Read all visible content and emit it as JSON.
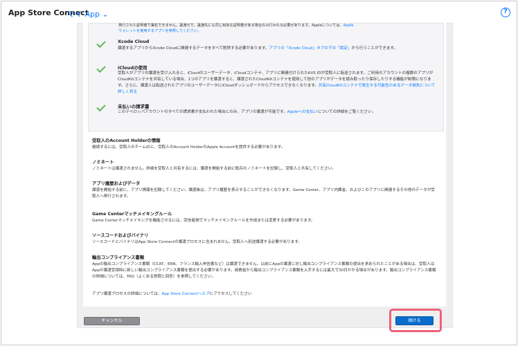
{
  "header": {
    "app_title": "App Store Connect",
    "my_apps": "マイ App ⌄",
    "help_icon": "?"
  },
  "top_fragment": {
    "line1": "発行された証明書で署名できません。譲渡元で、譲渡先にも同じ有効な証明書がある場合のみ行われる必要があります。Appleについては、",
    "line1_link": "Apple",
    "line2_link": "ウォレットを使用するアプリを参照してください。"
  },
  "checks": [
    {
      "title": "Xcode Cloud",
      "body_a": "譲渡するアプリからXcode Cloudに関連するデータをすべて削除する必要があります。",
      "body_link": "アプリの「Xcode Cloud」タブの下の「設定」",
      "body_b": "から行うことができます。"
    },
    {
      "title": "iCloudの使用",
      "body_a": "受取人がアプリの譲渡を受け入れると、iCloudのユーザーデータ、iCloudコンテナ、アプリに関連付けられたKVS IDが受取人に転送されます。ご利用のアカウントの複数のアプリがCloudKitコンテナを共有している場合、1つのアプリを譲渡すると、譲渡されたCloudKitコンテナを使用して他のアプリがデータを読み取ったり保存したりする機能が制限になります。さらに、譲渡人は転送されたアプリのユーザーデータにiCloudダッシュボードからアクセスできなくなります。",
      "body_link": "共有CloudKitコンテナで発生する可能性のあるデータ損失について詳しく見る",
      "body_b": ""
    },
    {
      "title": "未払いの請求書",
      "body_a": "このデベロッパアカウントのすべての請求書が支払われた場合にのみ、アプリの譲渡が可能です。",
      "body_link": "Appleへの支払い",
      "body_b": "についての詳細をご覧ください。"
    }
  ],
  "sections": [
    {
      "title": "受取人のAccount Holderの情報",
      "body": "継続するには、受取人のチームIDと、受取人のAccount HolderのApple Accountを提供する必要があります。"
    },
    {
      "title": "ノミネート",
      "body": "ノミネートは譲渡されません。詳細を受取人と共有するには、譲渡を開始する前に既存のノミネートを記録し、受取人と共有してください。"
    },
    {
      "title": "アプリ履歴およびデータ",
      "body": "譲渡を開始する前に、アプリ情報を記録してください。譲渡後は、アプリ履歴を表示することができなくなります。Game Center、アプリ内課金、およびこのアプリに関連するその他のデータが受取人へ移行されます。"
    },
    {
      "title": "Game Centerマッチメイキングルール",
      "body": "Game Centerマッチメイキングを機能させるには、受信者側でマッチメイキングルールを作成または変更する必要があります。"
    },
    {
      "title": "ソースコードおよびバイナリ",
      "body": "ソースコードとバイナリはApp Store Connectの譲渡プロセスに含まれません。受取人へ別途譲渡する必要があります。"
    },
    {
      "title": "輸出コンプライアンス書類",
      "body": "Appの輸出コンプライアンス書類（CCAT、ERN、フランス輸入申告書など）は譲渡できません。以前にAppの譲渡に対し輸出コンプライアンス書類の提出を求められたことがある場合は、受取人はAppの譲渡受領時に新しい輸出コンプライアンス書類を提出する必要があります。商務省から輸出コンプライアンス書類を入手するには最大で30日かかる場合があります。輸出コンプライアンス書類の詳細については、FAQ（よくある質問と回答）を参照してください。"
    }
  ],
  "footer_note": {
    "text_a": "アプリ譲渡プロセスの詳細については、",
    "link": "App Store Connectヘルプ",
    "text_b": "にアクセスしてください"
  },
  "buttons": {
    "cancel": "キャンセル",
    "continue": "続ける"
  },
  "colors": {
    "accent": "#0a7aff",
    "check": "#5cb85c",
    "highlight": "#f0607a",
    "continue_bg": "#0a6ccc",
    "cancel_bg": "#8e8e93"
  }
}
